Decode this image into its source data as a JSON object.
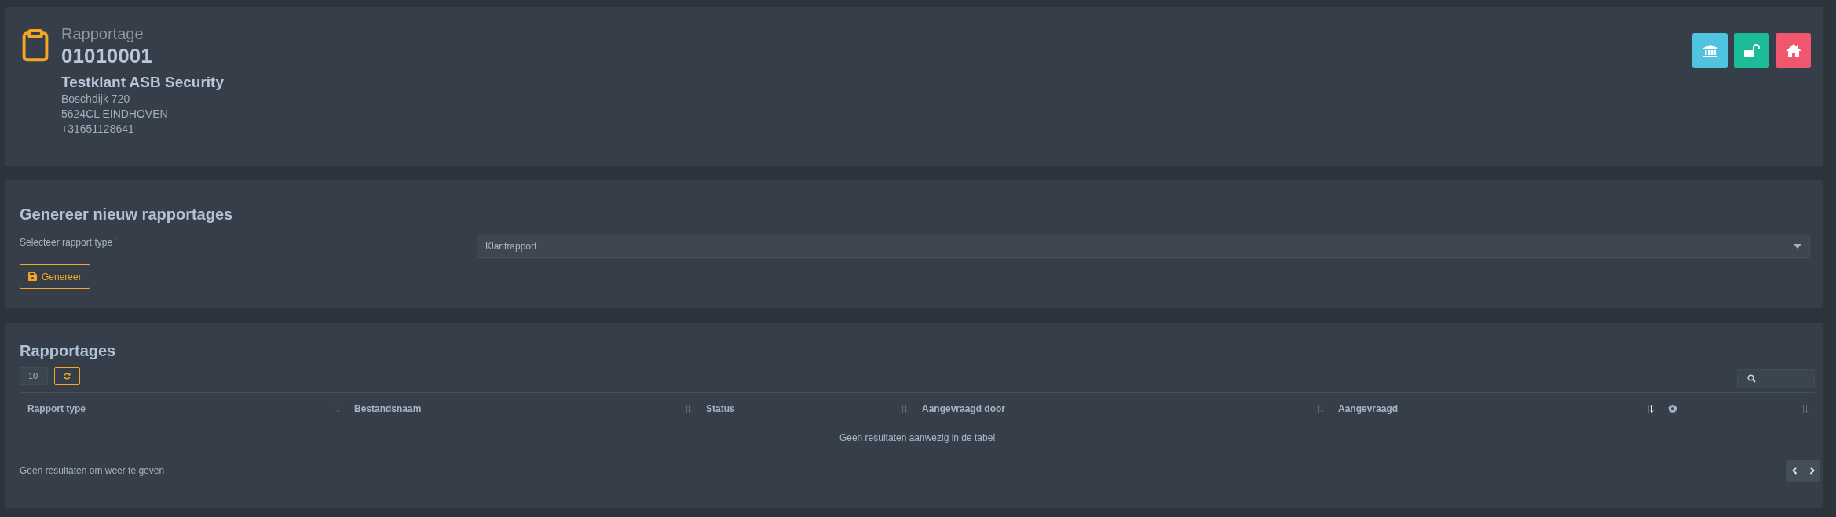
{
  "header": {
    "subtitle": "Rapportage",
    "number": "01010001",
    "customer": "Testklant ASB Security",
    "address_lines": [
      "Boschdijk 720",
      "5624CL EINDHOVEN",
      "+31651128641"
    ],
    "actions": [
      {
        "kind": "bank",
        "color": "#4fc3e0"
      },
      {
        "kind": "unlock",
        "color": "#1dbc98"
      },
      {
        "kind": "home",
        "color": "#f0566e"
      }
    ]
  },
  "generate": {
    "title": "Genereer nieuw rapportages",
    "field_label": "Selecteer rapport type",
    "required_marker": "*",
    "select_value": "Klantrapport",
    "button": "Genereer"
  },
  "reports": {
    "title": "Rapportages",
    "page_size": "10",
    "columns": [
      {
        "label": "Rapport type",
        "kind": "text",
        "sorted": false
      },
      {
        "label": "Bestandsnaam",
        "kind": "text",
        "sorted": false
      },
      {
        "label": "Status",
        "kind": "text",
        "sorted": false
      },
      {
        "label": "Aangevraagd door",
        "kind": "text",
        "sorted": false
      },
      {
        "label": "Aangevraagd",
        "kind": "text",
        "sorted": true
      },
      {
        "kind": "settings",
        "sorted": false
      }
    ],
    "empty_message": "Geen resultaten aanwezig in de tabel",
    "info": "Geen resultaten om weer te geven"
  }
}
